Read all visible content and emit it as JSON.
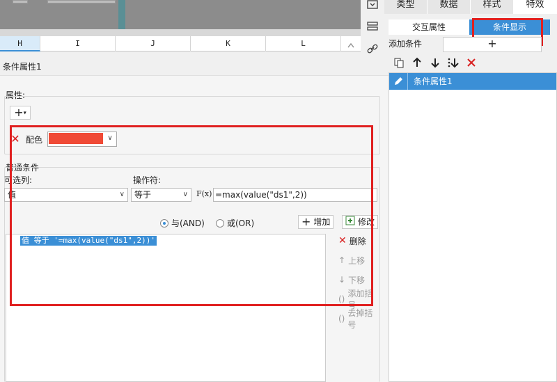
{
  "columns": [
    "H",
    "I",
    "J",
    "K",
    "L"
  ],
  "panel_title": "条件属性1",
  "right_tabs": [
    "类型",
    "数据",
    "样式",
    "特效"
  ],
  "sub_tabs": [
    "交互属性",
    "条件显示"
  ],
  "add_condition_label": "添加条件",
  "add_condition_plus": "+",
  "condition_list": [
    {
      "label": "条件属性1"
    }
  ],
  "attr_label": "属性:",
  "plus_button": "+",
  "color": {
    "label": "配色",
    "swatch_hex": "#f04a36"
  },
  "common_label": "普通条件",
  "optional_col_label": "可选列:",
  "operator_label": "操作符:",
  "column_value": "值",
  "operator_value": "等于",
  "fx_label": "F(x)",
  "formula_value": "=max(value(\"ds1\",2))",
  "and_label": "与(AND)",
  "or_label": "或(OR)",
  "add_button": "增加",
  "modify_button": "修改",
  "condition_expr": "值 等于 '=max(value(\"ds1\",2))'",
  "side_buttons": {
    "delete": "删除",
    "up": "上移",
    "down": "下移",
    "add_paren": "添加括号",
    "remove_paren": "去掉括号"
  },
  "accent": "#3b8fd6",
  "highlight": "#e02020"
}
